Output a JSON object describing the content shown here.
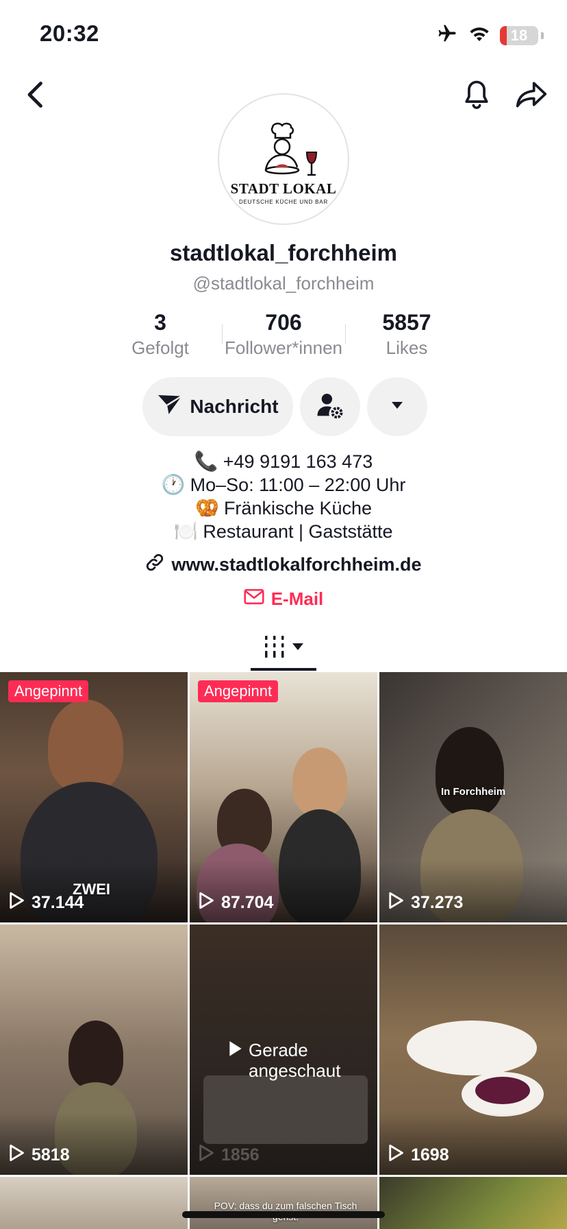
{
  "status_bar": {
    "time": "20:32",
    "battery": "18",
    "battery_level": 0.18,
    "icons": [
      "airplane-icon",
      "wifi-icon",
      "battery-icon"
    ]
  },
  "nav": {
    "back_icon": "chevron-left-icon",
    "bell_icon": "bell-icon",
    "share_icon": "share-icon"
  },
  "avatar": {
    "logo_title": "STADT LOKAL",
    "logo_subtitle": "DEUTSCHE KÜCHE UND BAR"
  },
  "profile": {
    "display_name": "stadtlokal_forchheim",
    "handle": "@stadtlokal_forchheim"
  },
  "stats": [
    {
      "value": "3",
      "label": "Gefolgt"
    },
    {
      "value": "706",
      "label": "Follower*innen"
    },
    {
      "value": "5857",
      "label": "Likes"
    }
  ],
  "actions": {
    "message_label": "Nachricht"
  },
  "bio": [
    {
      "emoji": "📞",
      "text": "+49 9191 163 473"
    },
    {
      "emoji": "🕐",
      "text": "Mo–So: 11:00 – 22:00 Uhr"
    },
    {
      "emoji": "🥨",
      "text": "Fränkische Küche"
    },
    {
      "emoji": "🍽️",
      "text": "Restaurant | Gaststätte"
    }
  ],
  "website": "www.stadtlokalforchheim.de",
  "email_label": "E-Mail",
  "colors": {
    "accent": "#fe2c55",
    "text": "#161823",
    "muted": "#8a8b91",
    "button_bg": "#f1f1f2"
  },
  "videos": [
    {
      "pinned": "Angepinnt",
      "views": "37.144",
      "overlay": "ZWEI"
    },
    {
      "pinned": "Angepinnt",
      "views": "87.704",
      "overlay": ""
    },
    {
      "pinned": "",
      "views": "37.273",
      "overlay": "In Forchheim"
    },
    {
      "pinned": "",
      "views": "5818",
      "overlay": ""
    },
    {
      "pinned": "",
      "views": "1856",
      "overlay": "",
      "watched": "Gerade angeschaut"
    },
    {
      "pinned": "",
      "views": "1698",
      "overlay": ""
    },
    {
      "pinned": "",
      "views": "",
      "overlay": ""
    },
    {
      "pinned": "",
      "views": "",
      "overlay": "POV: dass du zum falschen Tisch gehst."
    },
    {
      "pinned": "",
      "views": "",
      "overlay": ""
    }
  ]
}
